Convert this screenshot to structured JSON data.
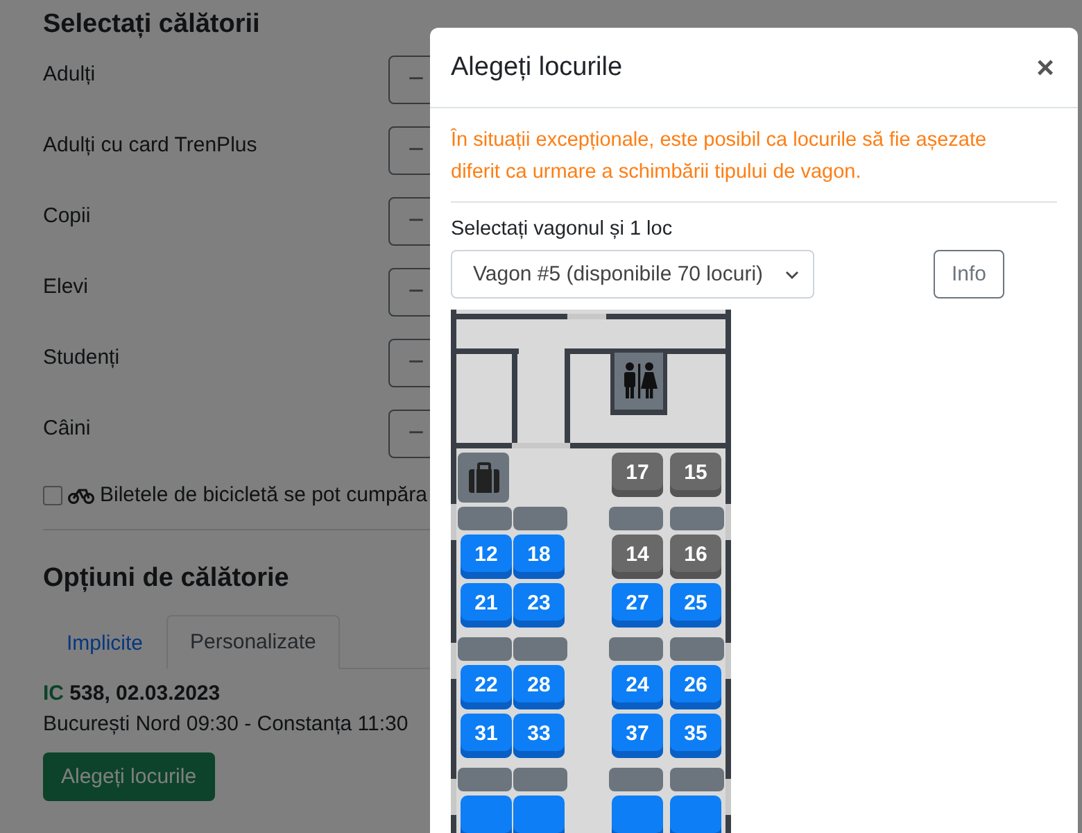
{
  "page": {
    "title": "Selectați călătorii",
    "counters": [
      {
        "label": "Adulți",
        "minus": "−"
      },
      {
        "label": "Adulți cu card TrenPlus",
        "minus": "−"
      },
      {
        "label": "Copii",
        "minus": "−"
      },
      {
        "label": "Elevi",
        "minus": "−"
      },
      {
        "label": "Studenți",
        "minus": "−"
      },
      {
        "label": "Câini",
        "minus": "−"
      }
    ],
    "bicycle": {
      "checked": false,
      "label": "Biletele de bicicletă se pot cumpăra"
    },
    "options_title": "Opțiuni de călătorie",
    "tabs": [
      {
        "label": "Implicite",
        "selected": false
      },
      {
        "label": "Personalizate",
        "selected": true
      }
    ],
    "train": {
      "type": "IC",
      "title": " 538, 02.03.2023",
      "route": "București Nord 09:30 - Constanța 11:30"
    },
    "choose_button": "Alegeți locurile"
  },
  "modal": {
    "title": "Alegeți locurile",
    "close": "×",
    "warning": "În situații excepționale, este posibil ca locurile să fie așezate diferit ca urmare a schimbării tipului de vagon.",
    "select_label": "Selectați vagonul și 1 loc",
    "wagon": "Vagon #5 (disponibile 70 locuri)",
    "info_button": "Info",
    "rows": [
      {
        "kind": "seats",
        "left": [
          {
            "kind": "luggage"
          }
        ],
        "right": [
          {
            "kind": "seat",
            "number": "17",
            "available": false
          },
          {
            "kind": "seat",
            "number": "15",
            "available": false
          }
        ]
      },
      {
        "kind": "tables"
      },
      {
        "kind": "seats",
        "left": [
          {
            "kind": "seat",
            "number": "12",
            "available": true
          },
          {
            "kind": "seat",
            "number": "18",
            "available": true
          }
        ],
        "right": [
          {
            "kind": "seat",
            "number": "14",
            "available": false
          },
          {
            "kind": "seat",
            "number": "16",
            "available": false
          }
        ]
      },
      {
        "kind": "seats",
        "left": [
          {
            "kind": "seat",
            "number": "21",
            "available": true
          },
          {
            "kind": "seat",
            "number": "23",
            "available": true
          }
        ],
        "right": [
          {
            "kind": "seat",
            "number": "27",
            "available": true
          },
          {
            "kind": "seat",
            "number": "25",
            "available": true
          }
        ]
      },
      {
        "kind": "tables"
      },
      {
        "kind": "seats",
        "left": [
          {
            "kind": "seat",
            "number": "22",
            "available": true
          },
          {
            "kind": "seat",
            "number": "28",
            "available": true
          }
        ],
        "right": [
          {
            "kind": "seat",
            "number": "24",
            "available": true
          },
          {
            "kind": "seat",
            "number": "26",
            "available": true
          }
        ]
      },
      {
        "kind": "seats",
        "left": [
          {
            "kind": "seat",
            "number": "31",
            "available": true
          },
          {
            "kind": "seat",
            "number": "33",
            "available": true
          }
        ],
        "right": [
          {
            "kind": "seat",
            "number": "37",
            "available": true
          },
          {
            "kind": "seat",
            "number": "35",
            "available": true
          }
        ]
      },
      {
        "kind": "tables"
      },
      {
        "kind": "seats",
        "left": [
          {
            "kind": "seat",
            "available": true
          },
          {
            "kind": "seat",
            "available": true
          }
        ],
        "right": [
          {
            "kind": "seat",
            "available": true
          },
          {
            "kind": "seat",
            "available": true
          }
        ]
      }
    ]
  }
}
